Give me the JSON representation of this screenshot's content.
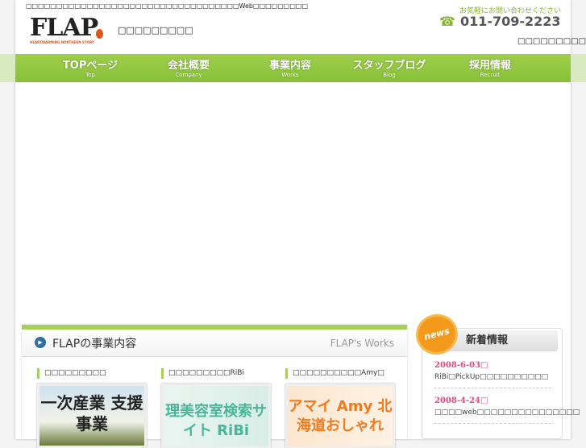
{
  "header": {
    "tagline": "□□□□□□□□□□□□□□□□□□□□□□□□□□□□□□□□□□□Web□□□□□□□□□",
    "logo_text": "FLAP",
    "logo_sub": "HEARTWARMING NORTHERN STORY",
    "site_name": "□□□□□□□□□",
    "contact_label": "お気軽にお問い合わせください",
    "phone": "011-709-2223",
    "sub_link": "□□□□□□□□□□□"
  },
  "nav": [
    {
      "label": "TOPページ",
      "sub": "Top"
    },
    {
      "label": "会社概要",
      "sub": "Company"
    },
    {
      "label": "事業内容",
      "sub": "Works"
    },
    {
      "label": "スタッフブログ",
      "sub": "Blog"
    },
    {
      "label": "採用情報",
      "sub": "Recruit"
    }
  ],
  "works": {
    "title": "FLAPの事業内容",
    "title_en": "FLAP's Works",
    "items": [
      {
        "caption": "□□□□□□□□□",
        "image_text": "一次産業 支援事業"
      },
      {
        "caption": "□□□□□□□□□RiBi",
        "image_text": "理美容室検索サイト RiBi"
      },
      {
        "caption": "□□□□□□□□□□Amy□",
        "image_text": "アマイ Amy 北海道おしゃれ"
      }
    ]
  },
  "news": {
    "badge": "news",
    "title": "新着情報",
    "items": [
      {
        "date": "2008-6-03□",
        "text": "RiBi□PickUp□□□□□□□□□□"
      },
      {
        "date": "2008-4-24□",
        "text": "□□□□web□□□□□□□□□□□□□□□"
      }
    ]
  }
}
